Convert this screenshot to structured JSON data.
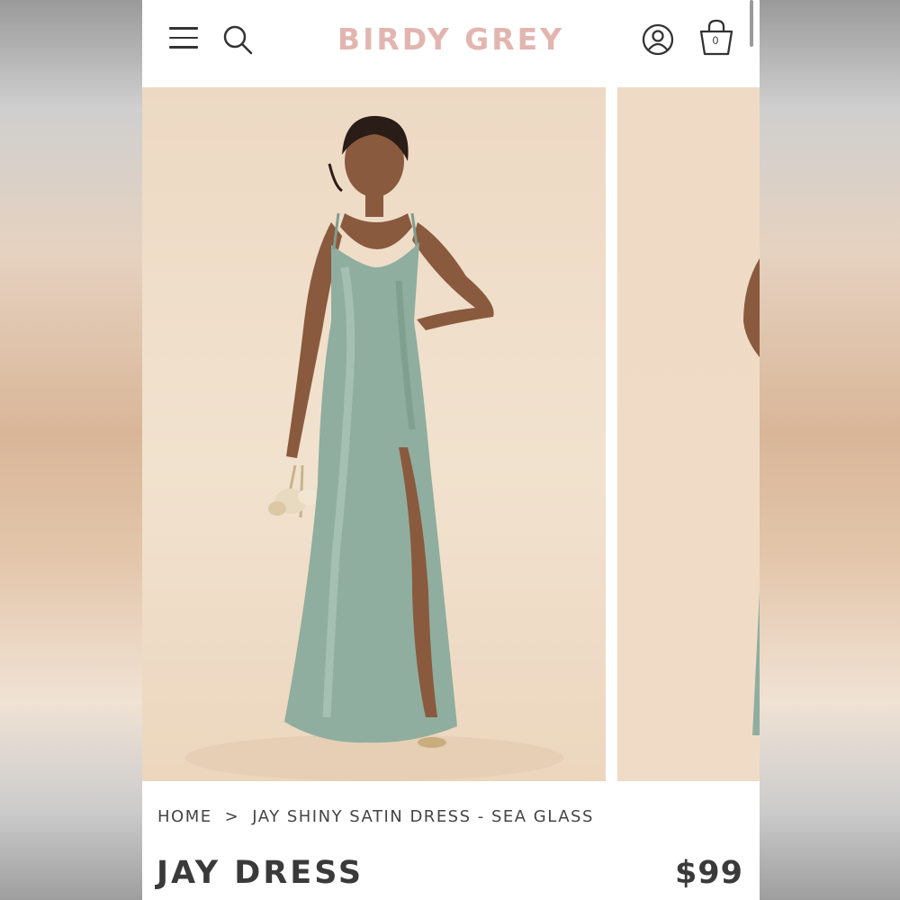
{
  "header": {
    "brand": "BIRDY GREY",
    "cart_count": "0",
    "brand_color": "#e3b5b0",
    "icons": [
      "menu-icon",
      "search-icon",
      "account-icon",
      "shopping-bag-icon"
    ]
  },
  "gallery": {
    "images": [
      {
        "alt": "Model wearing sea glass shiny satin slip dress with thigh slit"
      },
      {
        "alt": "Next product photo partially visible"
      }
    ],
    "backdrop_color": "#eedcc6",
    "dress_color": "#8fae9f"
  },
  "breadcrumb": {
    "home": "HOME",
    "separator": ">",
    "current": "JAY SHINY SATIN DRESS - SEA GLASS"
  },
  "product": {
    "title": "JAY DRESS",
    "price": "$99"
  }
}
